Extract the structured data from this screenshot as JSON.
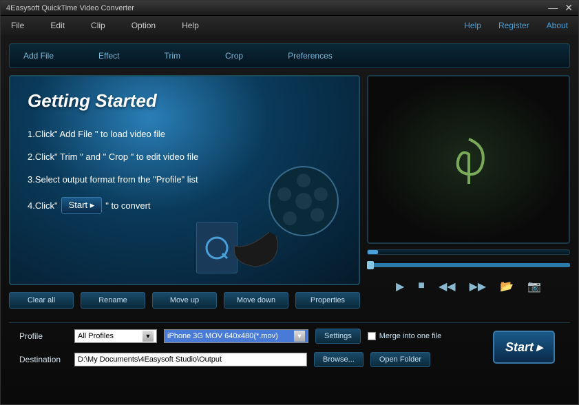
{
  "title": "4Easysoft QuickTime Video Converter",
  "menu": {
    "items": [
      "File",
      "Edit",
      "Clip",
      "Option",
      "Help"
    ],
    "right": [
      "Help",
      "Register",
      "About"
    ]
  },
  "toolbar": [
    "Add File",
    "Effect",
    "Trim",
    "Crop",
    "Preferences"
  ],
  "welcome": {
    "title": "Getting Started",
    "step1": "1.Click\" Add File \" to load video file",
    "step2": "2.Click\" Trim \" and \" Crop \" to edit video file",
    "step3": "3.Select output format from the \"Profile\" list",
    "step4a": "4.Click\"",
    "step4btn": "Start",
    "step4b": "\" to convert"
  },
  "actions": [
    "Clear all",
    "Rename",
    "Move up",
    "Move down",
    "Properties"
  ],
  "form": {
    "profile_label": "Profile",
    "profile_filter": "All Profiles",
    "profile_value": "iPhone 3G MOV 640x480(*.mov)",
    "settings_btn": "Settings",
    "merge_label": "Merge into one file",
    "dest_label": "Destination",
    "dest_value": "D:\\My Documents\\4Easysoft Studio\\Output",
    "browse_btn": "Browse...",
    "open_folder_btn": "Open Folder"
  },
  "start_btn": "Start"
}
